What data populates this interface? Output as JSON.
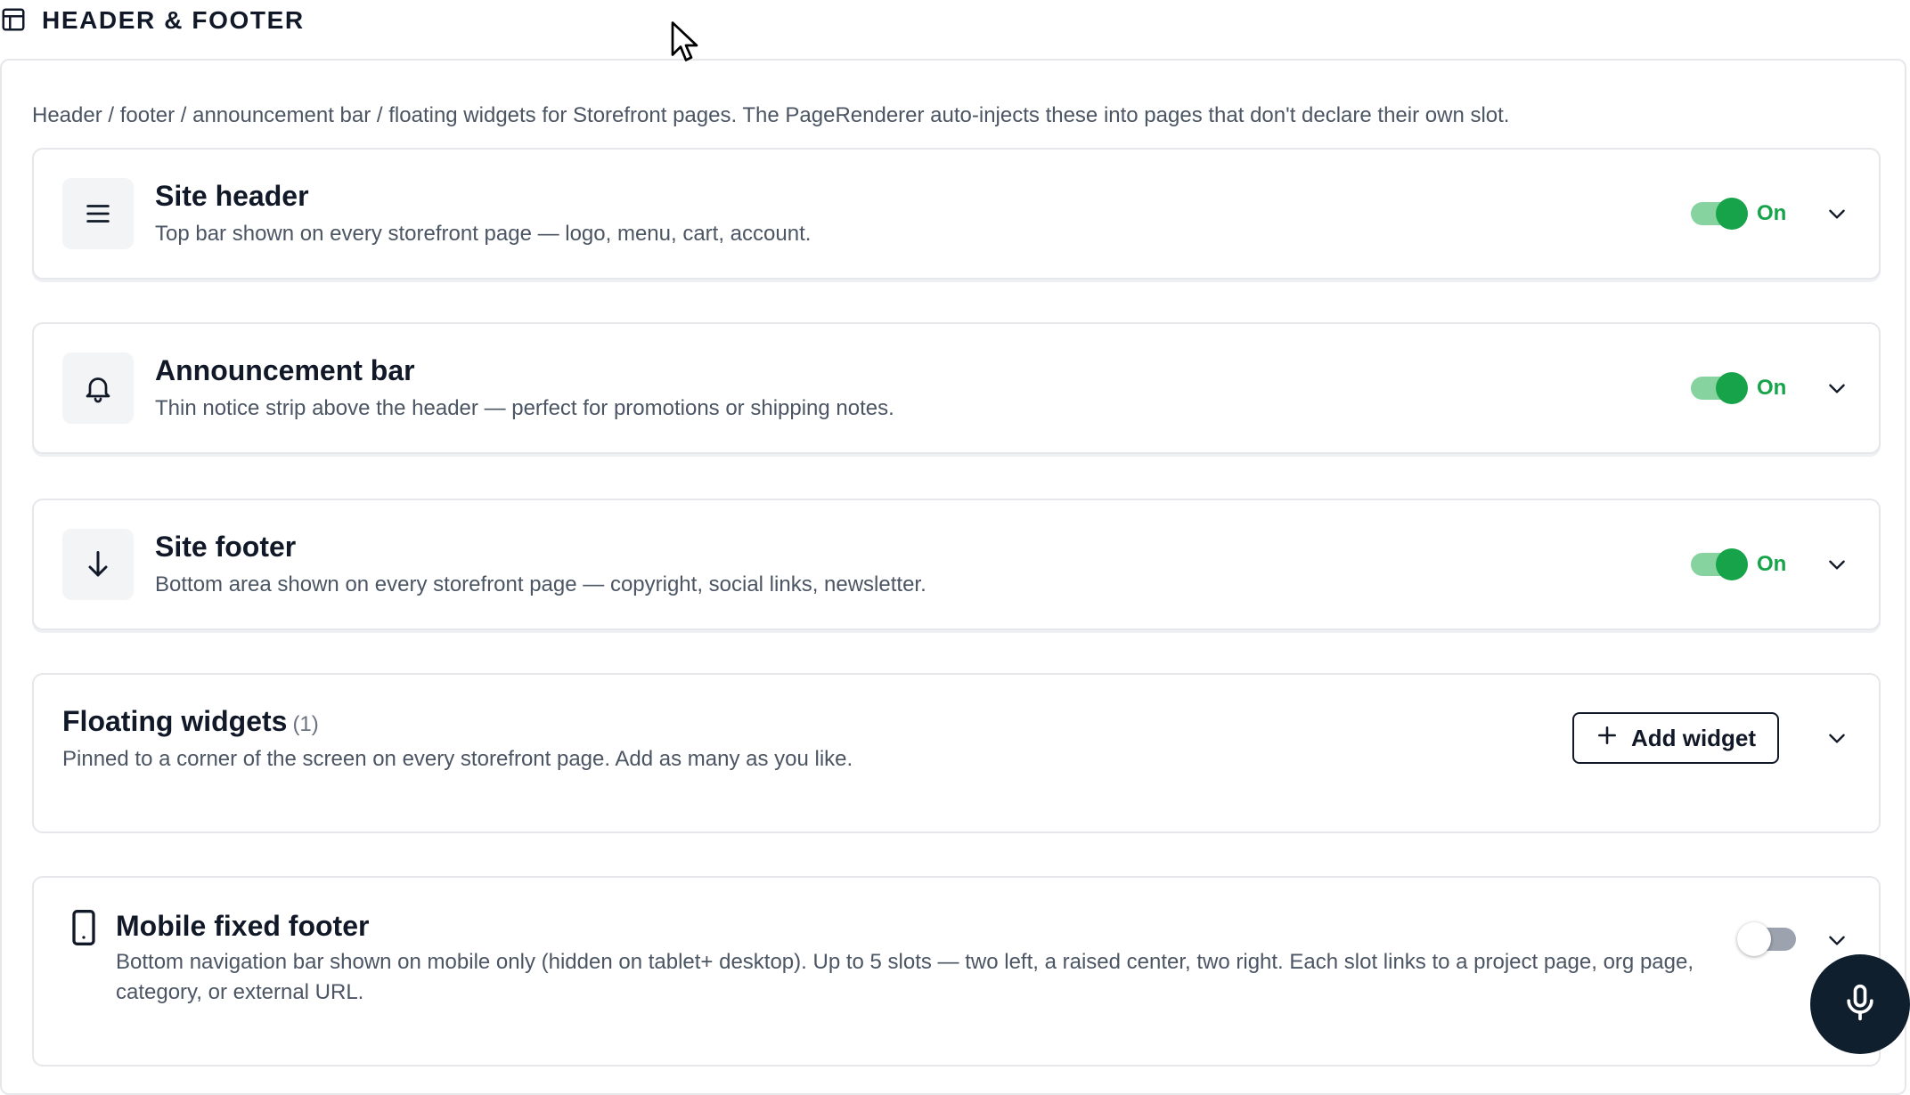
{
  "section": {
    "title": "HEADER & FOOTER",
    "icon": "layout-icon",
    "description": "Header / footer / announcement bar / floating widgets for Storefront pages. The PageRenderer auto-injects these into pages that don't declare their own slot."
  },
  "cards": [
    {
      "title": "Site header",
      "subtitle": "Top bar shown on every storefront page — logo, menu, cart, account.",
      "icon": "menu-icon",
      "enabled": true,
      "status_label": "On"
    },
    {
      "title": "Announcement bar",
      "subtitle": "Thin notice strip above the header — perfect for promotions or shipping notes.",
      "icon": "bell-icon",
      "enabled": true,
      "status_label": "On"
    },
    {
      "title": "Site footer",
      "subtitle": "Bottom area shown on every storefront page — copyright, social links, newsletter.",
      "icon": "arrow-down-icon",
      "enabled": true,
      "status_label": "On"
    }
  ],
  "floating_widgets": {
    "title": "Floating widgets",
    "count": "(1)",
    "subtitle": "Pinned to a corner of the screen on every storefront page. Add as many as you like.",
    "add_button_label": "Add widget"
  },
  "mobile_footer": {
    "title": "Mobile fixed footer",
    "subtitle": "Bottom navigation bar shown on mobile only (hidden on tablet+ desktop). Up to 5 slots — two left, a raised center, two right. Each slot links to a project page, org page, category, or external URL.",
    "icon": "mobile-icon",
    "enabled": false
  },
  "voice_button": {
    "icon": "microphone-icon"
  },
  "colors": {
    "accent_green": "#16a34a",
    "toggle_track_on": "#86d3a0",
    "toggle_track_off": "#9ca3af",
    "voice_button_bg": "#0f1f2e"
  }
}
